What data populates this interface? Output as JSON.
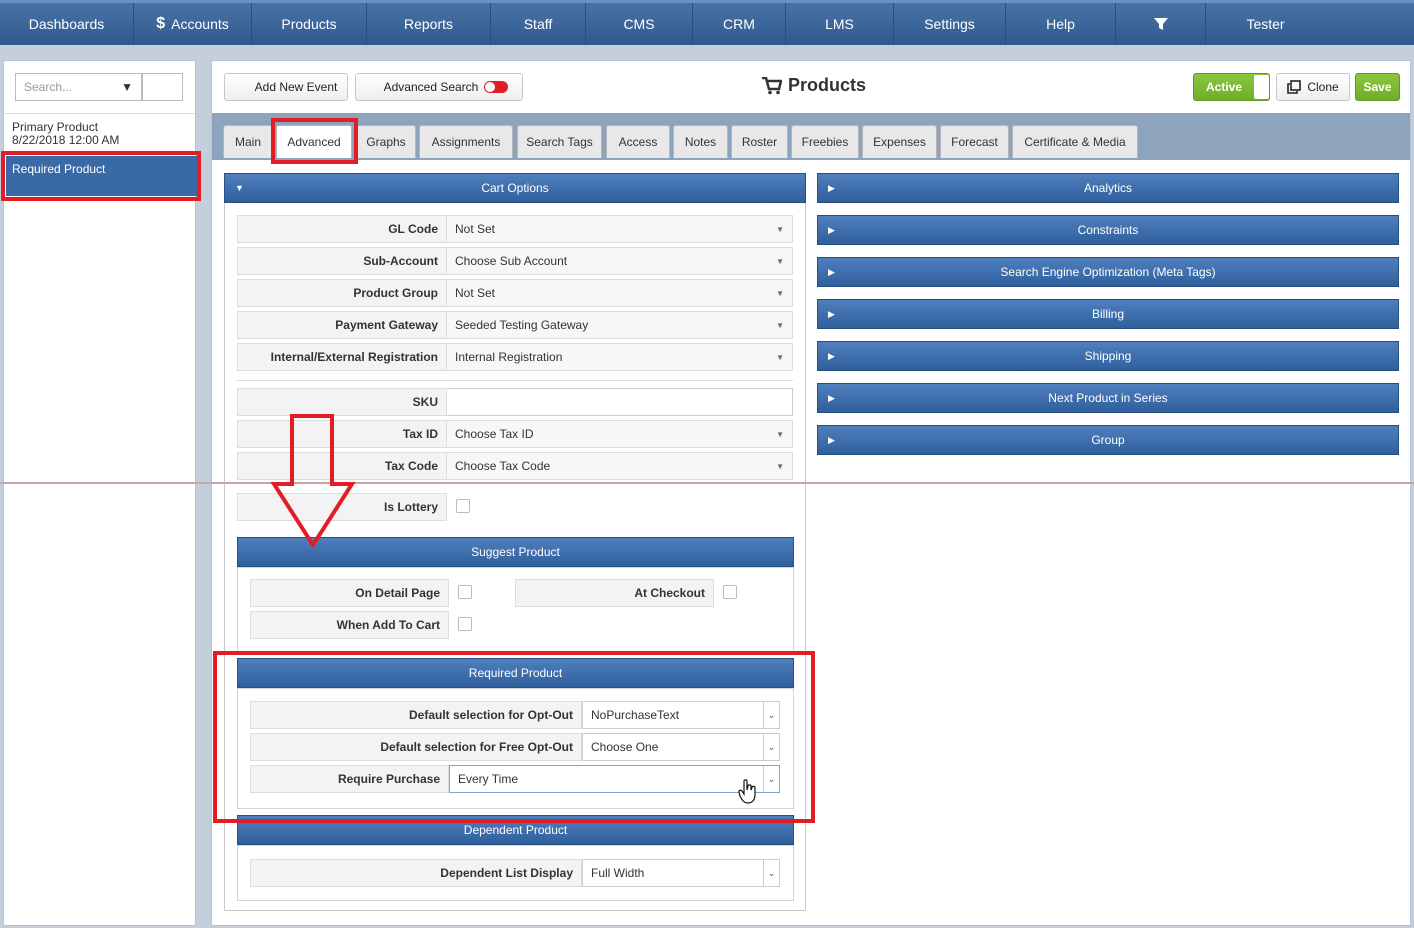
{
  "topnav": {
    "items": [
      "Dashboards",
      "Accounts",
      "Products",
      "Reports",
      "Staff",
      "CMS",
      "CRM",
      "LMS",
      "Settings",
      "Help"
    ],
    "accounts_icon": "$",
    "filter_icon": "filter-icon",
    "user": "Tester"
  },
  "sidebar": {
    "search_placeholder": "Search...",
    "primary_item": "Primary Product",
    "primary_date": "8/22/2018 12:00 AM",
    "active_item": "Required Product"
  },
  "toolbar": {
    "add_event": "Add New Event",
    "advanced_search": "Advanced Search",
    "title": "Products",
    "active_label": "Active",
    "clone_label": "Clone",
    "save_label": "Save"
  },
  "tabs": [
    "Main",
    "Advanced",
    "Graphs",
    "Assignments",
    "Search Tags",
    "Access",
    "Notes",
    "Roster",
    "Freebies",
    "Expenses",
    "Forecast",
    "Certificate & Media"
  ],
  "cart_options": {
    "title": "Cart Options",
    "fields": [
      {
        "label": "GL Code",
        "value": "Not Set"
      },
      {
        "label": "Sub-Account",
        "value": "Choose Sub Account"
      },
      {
        "label": "Product Group",
        "value": "Not Set"
      },
      {
        "label": "Payment Gateway",
        "value": "Seeded Testing Gateway"
      },
      {
        "label": "Internal/External Registration",
        "value": "Internal Registration"
      }
    ],
    "sku_label": "SKU",
    "sku_value": "",
    "tax_id_label": "Tax ID",
    "tax_id_value": "Choose Tax ID",
    "tax_code_label": "Tax Code",
    "tax_code_value": "Choose Tax Code",
    "lottery_label": "Is Lottery"
  },
  "suggest": {
    "title": "Suggest Product",
    "detail": "On Detail Page",
    "checkout": "At Checkout",
    "add_to_cart": "When Add To Cart"
  },
  "required": {
    "title": "Required Product",
    "optout_label": "Default selection for Opt-Out",
    "optout_value": "NoPurchaseText",
    "free_optout_label": "Default selection for Free Opt-Out",
    "free_optout_value": "Choose One",
    "require_label": "Require Purchase",
    "require_value": "Every Time"
  },
  "dependent": {
    "title": "Dependent Product",
    "display_label": "Dependent List Display",
    "display_value": "Full Width"
  },
  "right_sections": [
    "Analytics",
    "Constraints",
    "Search Engine Optimization (Meta Tags)",
    "Billing",
    "Shipping",
    "Next Product in Series",
    "Group"
  ],
  "colors": {
    "nav": "#3a659a",
    "section": "#3e6eac",
    "highlight": "#e21d25",
    "active_green": "#7dba34"
  }
}
